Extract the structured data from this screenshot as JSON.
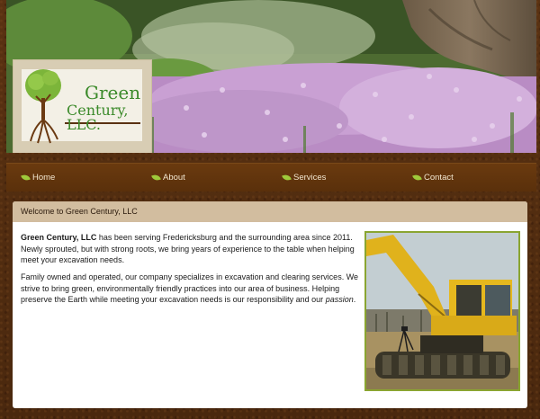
{
  "logo": {
    "line1": "Green",
    "line2": "Century, LLC."
  },
  "nav": {
    "items": [
      {
        "label": "Home"
      },
      {
        "label": "About"
      },
      {
        "label": "Services"
      },
      {
        "label": "Contact"
      }
    ]
  },
  "content": {
    "title": "Welcome to Green Century, LLC",
    "p1_strong": "Green Century, LLC",
    "p1_rest": " has been serving Fredericksburg and the surrounding area since 2011. Newly sprouted, but with strong roots, we bring years of experience to the table when helping meet your excavation needs.",
    "p2_main": "Family owned and operated, our company specializes in excavation and clearing services. We strive to bring green, environmentally friendly practices into our area of business. Helping preserve the Earth while meeting your excavation needs is our responsibility and our ",
    "p2_italic": "passion",
    "p2_end": "."
  },
  "colors": {
    "brown_bg": "#5a3212",
    "nav_bg": "#6a3a0f",
    "title_bar": "#d2bd9f",
    "accent_green": "#8aa531",
    "logo_green": "#3b8a2a"
  }
}
